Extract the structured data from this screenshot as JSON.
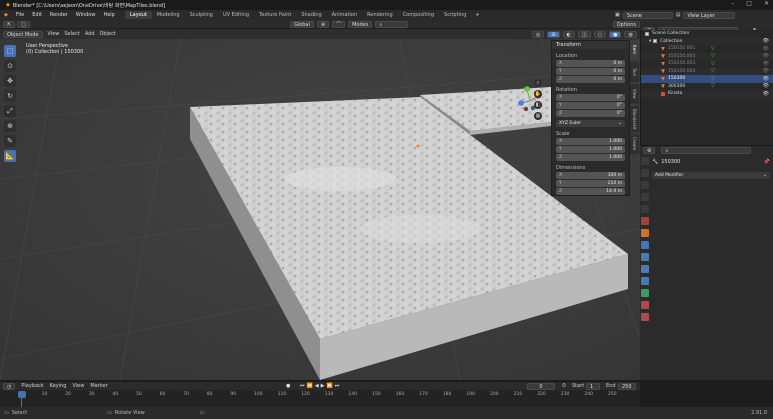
{
  "window": {
    "title": "Blender* [C:\\Users\\sejeon\\OneDrive\\바탕 화면\\MapTiles.blend]"
  },
  "menu": [
    "File",
    "Edit",
    "Render",
    "Window",
    "Help"
  ],
  "workspaces": [
    "Layout",
    "Modeling",
    "Sculpting",
    "UV Editing",
    "Texture Paint",
    "Shading",
    "Animation",
    "Rendering",
    "Compositing",
    "Scripting"
  ],
  "scene": {
    "name": "Scene",
    "view_layer": "View Layer"
  },
  "header": {
    "transform_orient": "Global",
    "snap": "Modes",
    "options": "Options"
  },
  "viewport_header": {
    "mode": "Object Mode",
    "view": "View",
    "select": "Select",
    "add": "Add",
    "object": "Object"
  },
  "viewport": {
    "perspective": "User Perspective",
    "collection_info": "(0) Collection | 150300"
  },
  "npanel": {
    "title": "Transform",
    "location_label": "Location",
    "location": [
      {
        "k": "X",
        "v": "0 m"
      },
      {
        "k": "Y",
        "v": "0 m"
      },
      {
        "k": "Z",
        "v": "0 m"
      }
    ],
    "rotation_label": "Rotation",
    "rotation": [
      {
        "k": "X",
        "v": "0°"
      },
      {
        "k": "Y",
        "v": "0°"
      },
      {
        "k": "Z",
        "v": "0°"
      }
    ],
    "rotation_mode": "XYZ Euler",
    "scale_label": "Scale",
    "scale": [
      {
        "k": "X",
        "v": "1.000"
      },
      {
        "k": "Y",
        "v": "1.000"
      },
      {
        "k": "Z",
        "v": "1.000"
      }
    ],
    "dimensions_label": "Dimensions",
    "dimensions": [
      {
        "k": "X",
        "v": "300 m"
      },
      {
        "k": "Y",
        "v": "210 m"
      },
      {
        "k": "Z",
        "v": "14.9 m"
      }
    ]
  },
  "vtabs": [
    "Item",
    "Tool",
    "View",
    "Blenderkit",
    "Create"
  ],
  "outliner": {
    "root": "Scene Collection",
    "collection": "Collection",
    "items": [
      "150150.001",
      "150150.003",
      "150150.003",
      "150150.004",
      "150300",
      "300300",
      "Kinata"
    ]
  },
  "properties": {
    "object_name": "150300",
    "add_modifier": "Add Modifier"
  },
  "timeline": {
    "menu": [
      "Playback",
      "Keying",
      "View",
      "Marker"
    ],
    "current_frame": "0",
    "start_label": "Start",
    "start": "1",
    "end_label": "End",
    "end": "250",
    "ticks": [
      "0",
      "10",
      "20",
      "30",
      "40",
      "50",
      "60",
      "70",
      "80",
      "90",
      "100",
      "110",
      "120",
      "130",
      "140",
      "150",
      "160",
      "170",
      "180",
      "190",
      "200",
      "210",
      "220",
      "230",
      "240",
      "250"
    ]
  },
  "status": {
    "left": "Select",
    "middle": "Rotate View",
    "version": "2.91.0"
  }
}
